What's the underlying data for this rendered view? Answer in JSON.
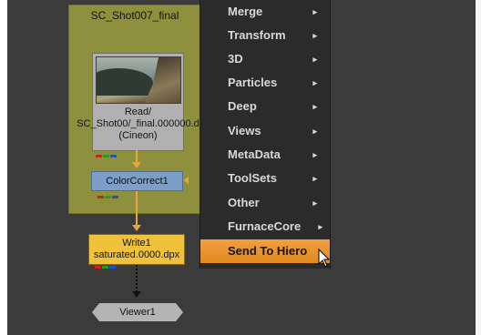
{
  "backdrop": {
    "title": "SC_Shot007_final",
    "color": "#8f903d"
  },
  "read_node": {
    "line1": "Read/",
    "line2": "SC_Shot00/_final.000000.d",
    "line3": "(Cineon)"
  },
  "colorcorrect_node": {
    "label": "ColorCorrect1"
  },
  "write_node": {
    "line1": "Write1",
    "line2": "saturated.0000.dpx"
  },
  "viewer_node": {
    "label": "Viewer1"
  },
  "context_menu": {
    "items": [
      {
        "label": "Merge",
        "submenu": "▸"
      },
      {
        "label": "Transform",
        "submenu": "▸"
      },
      {
        "label": "3D",
        "submenu": "▸"
      },
      {
        "label": "Particles",
        "submenu": "▸"
      },
      {
        "label": "Deep",
        "submenu": "▸"
      },
      {
        "label": "Views",
        "submenu": "▸"
      },
      {
        "label": "MetaData",
        "submenu": "▸"
      },
      {
        "label": "ToolSets",
        "submenu": "▸"
      },
      {
        "label": "Other",
        "submenu": "▸"
      },
      {
        "label": "FurnaceCore",
        "submenu": "▸"
      },
      {
        "label": "Send To Hiero"
      }
    ],
    "highlighted": "Send To Hiero",
    "highlight_color": "#e8952c"
  },
  "colors": {
    "wire": "#e5a73a",
    "canvas": "#3b3b3b",
    "menu_bg": "#2b2b2b"
  }
}
